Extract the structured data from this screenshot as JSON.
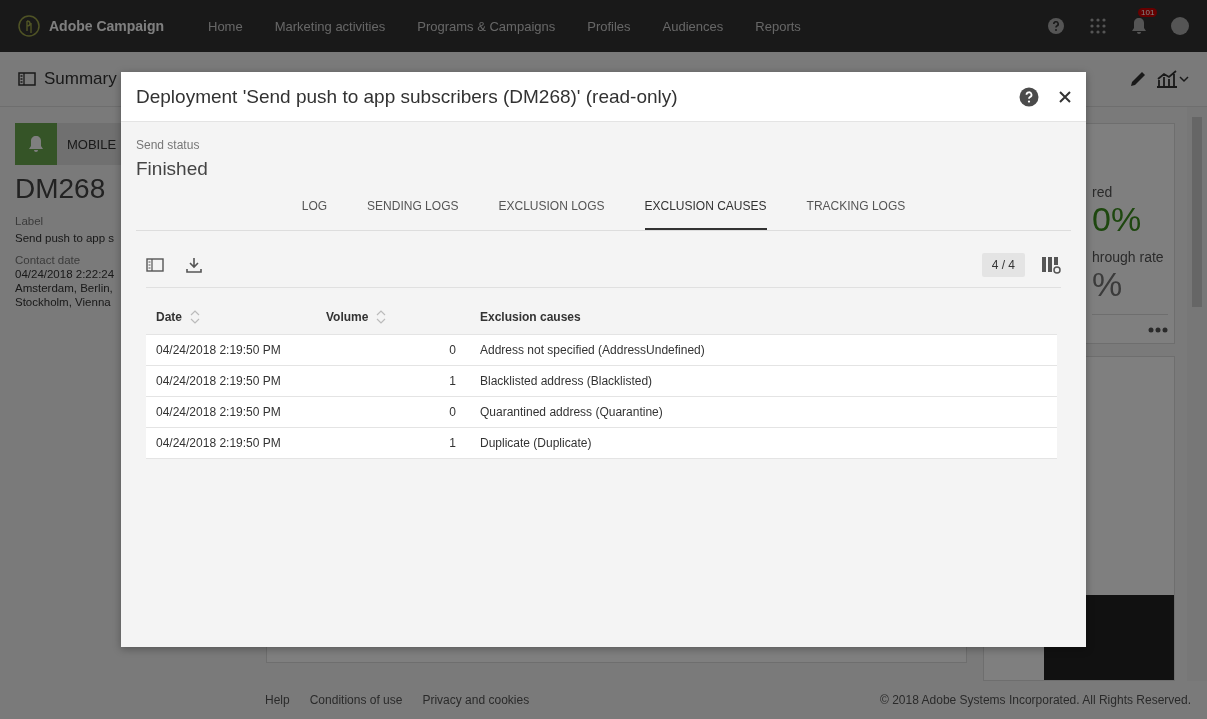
{
  "app": {
    "brand": "Adobe Campaign",
    "nav": [
      {
        "label": "Home"
      },
      {
        "label": "Marketing activities"
      },
      {
        "label": "Programs & Campaigns"
      },
      {
        "label": "Profiles"
      },
      {
        "label": "Audiences"
      },
      {
        "label": "Reports"
      }
    ],
    "notifications": "101"
  },
  "subheader": {
    "title": "Summary"
  },
  "left_panel": {
    "channel": "MOBILE",
    "name": "DM268",
    "label_caption": "Label",
    "label_value": "Send push to app s",
    "contact_caption": "Contact date",
    "contact_lines": [
      "04/24/2018 2:22:24",
      "Amsterdam, Berlin,",
      "Stockholm, Vienna"
    ]
  },
  "right_panel": {
    "metric_1_caption": "red",
    "metric_1_value": "0%",
    "metric_2_caption": "hrough rate",
    "metric_2_value": "%"
  },
  "footer": {
    "links": [
      "Help",
      "Conditions of use",
      "Privacy and cookies"
    ],
    "copyright": "© 2018 Adobe Systems Incorporated. All Rights Reserved."
  },
  "dialog": {
    "title": "Deployment 'Send push to app subscribers (DM268)' (read-only)",
    "status_caption": "Send status",
    "status_value": "Finished",
    "tabs": [
      {
        "label": "LOG",
        "selected": false
      },
      {
        "label": "SENDING LOGS",
        "selected": false
      },
      {
        "label": "EXCLUSION LOGS",
        "selected": false
      },
      {
        "label": "EXCLUSION CAUSES",
        "selected": true
      },
      {
        "label": "TRACKING LOGS",
        "selected": false
      }
    ],
    "count": "4 / 4",
    "table": {
      "columns": [
        {
          "label": "Date",
          "sortable": true
        },
        {
          "label": "Volume",
          "sortable": true
        },
        {
          "label": "Exclusion causes",
          "sortable": false
        }
      ],
      "rows": [
        [
          "04/24/2018 2:19:50 PM",
          "0",
          "Address not specified (AddressUndefined)"
        ],
        [
          "04/24/2018 2:19:50 PM",
          "1",
          "Blacklisted address (Blacklisted)"
        ],
        [
          "04/24/2018 2:19:50 PM",
          "0",
          "Quarantined address (Quarantine)"
        ],
        [
          "04/24/2018 2:19:50 PM",
          "1",
          "Duplicate (Duplicate)"
        ]
      ]
    }
  }
}
